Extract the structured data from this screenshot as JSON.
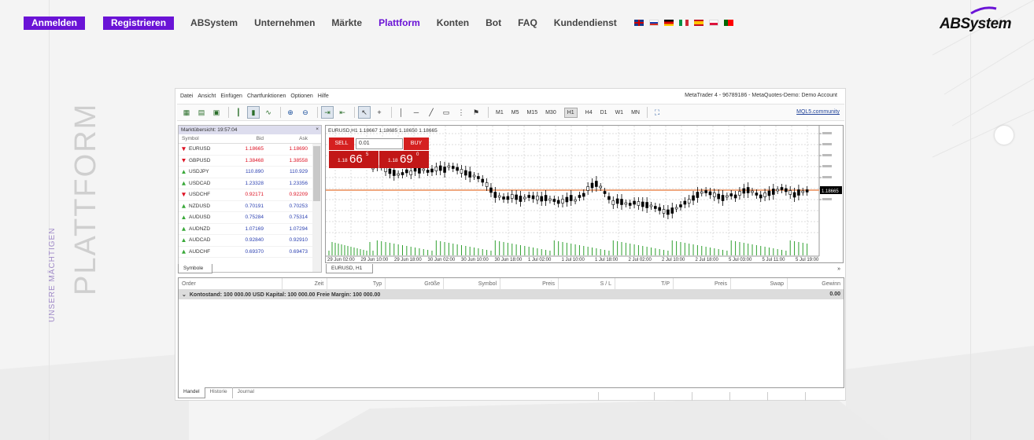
{
  "nav": {
    "login": "Anmelden",
    "register": "Registrieren",
    "links": [
      "ABSystem",
      "Unternehmen",
      "Märkte",
      "Plattform",
      "Konten",
      "Bot",
      "FAQ",
      "Kundendienst"
    ],
    "active": "Plattform",
    "flags": [
      {
        "name": "english-flag-icon"
      },
      {
        "name": "russian-flag-icon"
      },
      {
        "name": "german-flag-icon"
      },
      {
        "name": "italian-flag-icon"
      },
      {
        "name": "spanish-flag-icon"
      },
      {
        "name": "polish-flag-icon"
      },
      {
        "name": "portuguese-flag-icon"
      }
    ]
  },
  "logo": {
    "text": "ABSystem"
  },
  "side": {
    "small": "UNSERE MÄCHTIGEN",
    "big": "PLATTFORM"
  },
  "terminal": {
    "menu": [
      "Datei",
      "Ansicht",
      "Einfügen",
      "Chartfunktionen",
      "Optionen",
      "Hilfe"
    ],
    "title": "MetaTrader 4 - 96789186 - MetaQuotes-Demo: Demo Account",
    "timeframes": [
      "M1",
      "M5",
      "M15",
      "M30",
      "H1",
      "H4",
      "D1",
      "W1",
      "MN"
    ],
    "active_tf": "H1",
    "mql": "MQL5.community",
    "market_watch": {
      "title": "Marktübersicht: 19:57:04",
      "close": "×",
      "cols": [
        "Symbol",
        "Bid",
        "Ask"
      ],
      "rows": [
        {
          "sym": "EURUSD",
          "bid": "1.18665",
          "ask": "1.18690",
          "dir": "dn"
        },
        {
          "sym": "GBPUSD",
          "bid": "1.38468",
          "ask": "1.38558",
          "dir": "dn"
        },
        {
          "sym": "USDJPY",
          "bid": "110.890",
          "ask": "110.929",
          "dir": "up"
        },
        {
          "sym": "USDCAD",
          "bid": "1.23328",
          "ask": "1.23356",
          "dir": "up"
        },
        {
          "sym": "USDCHF",
          "bid": "0.92171",
          "ask": "0.92209",
          "dir": "dn"
        },
        {
          "sym": "NZDUSD",
          "bid": "0.70191",
          "ask": "0.70253",
          "dir": "up"
        },
        {
          "sym": "AUDUSD",
          "bid": "0.75284",
          "ask": "0.75314",
          "dir": "up"
        },
        {
          "sym": "AUDNZD",
          "bid": "1.07169",
          "ask": "1.07294",
          "dir": "up"
        },
        {
          "sym": "AUDCAD",
          "bid": "0.92840",
          "ask": "0.92910",
          "dir": "up"
        },
        {
          "sym": "AUDCHF",
          "bid": "0.69370",
          "ask": "0.69473",
          "dir": "up"
        }
      ],
      "tab": "Symbole"
    },
    "chart": {
      "header": "EURUSD,H1  1.18667 1.18685 1.18650 1.18665",
      "sell": "SELL",
      "buy": "BUY",
      "lot": "0.01",
      "sell_small": "1.18",
      "sell_big": "66",
      "sell_tiny": "5",
      "buy_small": "1.18",
      "buy_big": "69",
      "buy_tiny": "0",
      "price_labels": [
        "1.18665"
      ],
      "x_labels": [
        "29 Jun 02:00",
        "29 Jun 10:00",
        "29 Jun 18:00",
        "30 Jun 02:00",
        "30 Jun 10:00",
        "30 Jun 18:00",
        "1 Jul 02:00",
        "1 Jul 10:00",
        "1 Jul 18:00",
        "2 Jul 02:00",
        "2 Jul 10:00",
        "2 Jul 18:00",
        "5 Jul 03:00",
        "5 Jul 11:00",
        "5 Jul 19:00"
      ],
      "tab": "EURUSD, H1"
    },
    "orders": {
      "cols": [
        "Order",
        "Zeit",
        "Typ",
        "Größe",
        "Symbol",
        "Preis",
        "S / L",
        "T/P",
        "Preis",
        "Swap",
        "Gewinn"
      ],
      "balance": "Kontostand: 100 000.00 USD  Kapital: 100 000.00  Freie Margin: 100 000.00",
      "total": "0.00"
    },
    "bottom_tabs": [
      "Handel",
      "Historie",
      "Journal"
    ]
  }
}
